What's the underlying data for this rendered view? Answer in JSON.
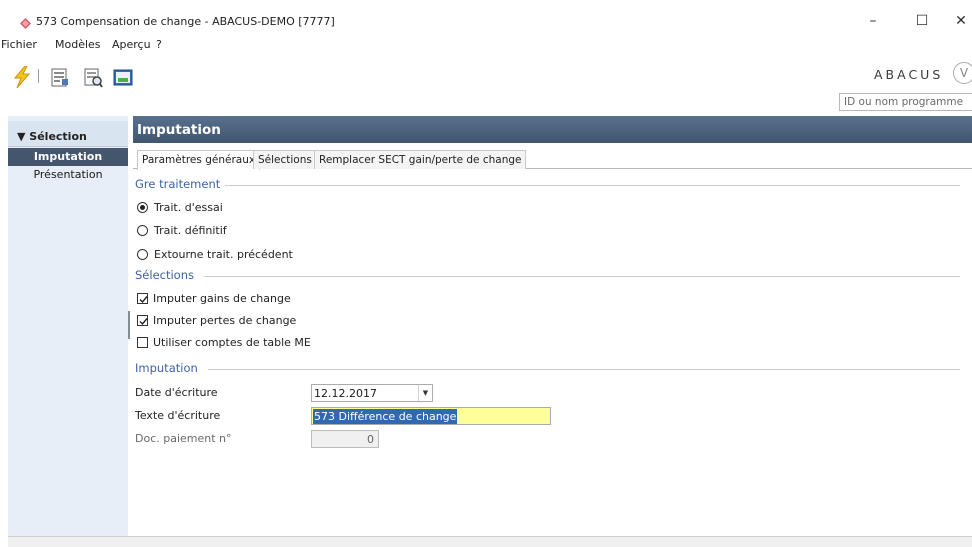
{
  "window": {
    "title": "573 Compensation de change - ABACUS-DEMO [7777]",
    "minimize": "–",
    "maximize": "☐",
    "close": "✕"
  },
  "menu": {
    "items": [
      "Fichier",
      "Modèles",
      "Aperçu",
      "?"
    ]
  },
  "toolbar": {
    "icons": [
      "lightning-icon",
      "document-settings-icon",
      "preview-icon",
      "export-icon"
    ]
  },
  "brand": {
    "name": "ABACUS",
    "badge": "V"
  },
  "search": {
    "placeholder": "ID ou nom programme"
  },
  "sidebar": {
    "header": "▼ Sélection",
    "items": [
      {
        "label": "Imputation",
        "active": true
      },
      {
        "label": "Présentation",
        "active": false
      }
    ]
  },
  "main": {
    "title": "Imputation",
    "tabs": [
      "Paramètres généraux",
      "Sélections",
      "Remplacer SECT gain/perte de change"
    ],
    "active_tab": 0
  },
  "groups": {
    "traitement": {
      "title": "Gre traitement",
      "options": [
        {
          "label": "Trait. d'essai",
          "selected": true
        },
        {
          "label": "Trait. définitif",
          "selected": false
        },
        {
          "label": "Extourne trait. précédent",
          "selected": false
        }
      ]
    },
    "selections": {
      "title": "Sélections",
      "options": [
        {
          "label": "Imputer gains de change",
          "checked": true
        },
        {
          "label": "Imputer pertes de change",
          "checked": true
        },
        {
          "label": "Utiliser comptes de table ME",
          "checked": false
        }
      ]
    },
    "imputation": {
      "title": "Imputation",
      "date_label": "Date d'écriture",
      "date_value": "12.12.2017",
      "text_label": "Texte d'écriture",
      "text_value": "573 Différence de change",
      "doc_label": "Doc. paiement n°",
      "doc_value": "0"
    }
  },
  "colors": {
    "header_bg": "#4d6480",
    "nav_active": "#44566e",
    "group_title": "#3f63a2",
    "highlight_field": "#ffff99",
    "selection": "#2f69b4"
  }
}
